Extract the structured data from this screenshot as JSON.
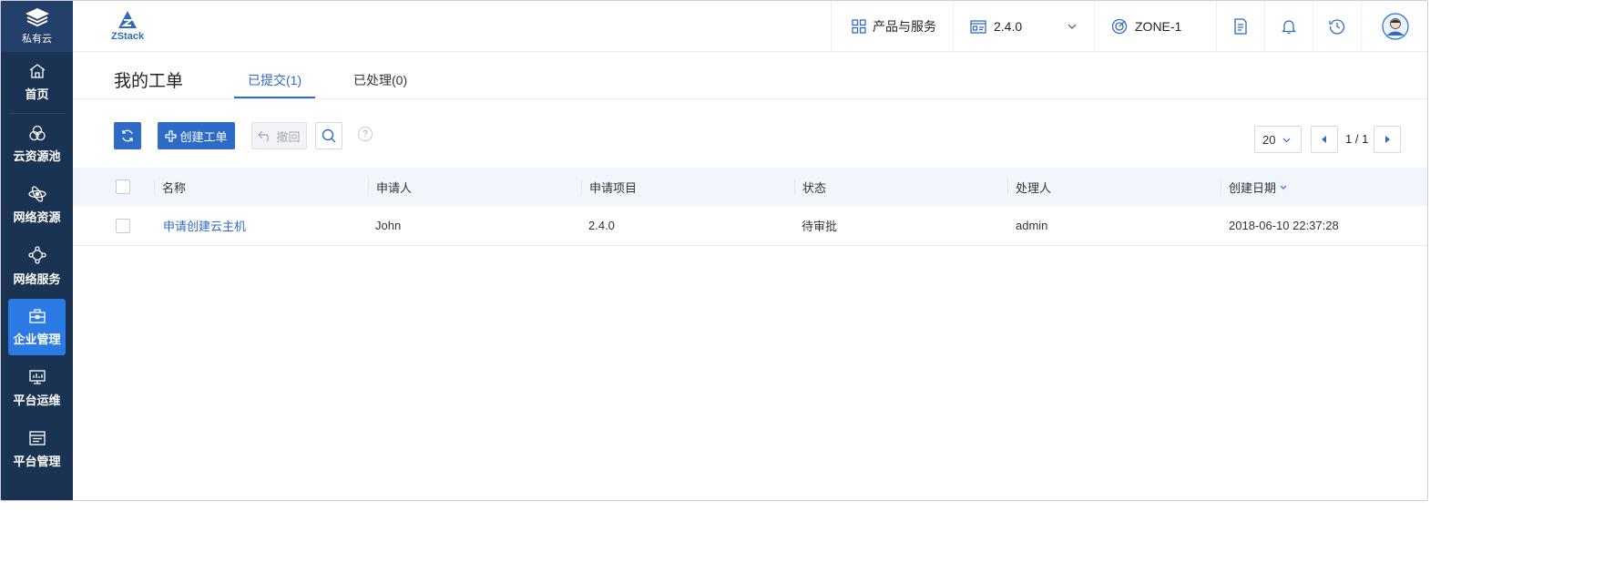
{
  "sidebar": {
    "brand_label": "私有云",
    "items": [
      {
        "label": "首页",
        "icon": "home-icon"
      },
      {
        "label": "云资源池",
        "icon": "resource-pool-icon"
      },
      {
        "label": "网络资源",
        "icon": "network-resource-icon"
      },
      {
        "label": "网络服务",
        "icon": "network-service-icon"
      },
      {
        "label": "企业管理",
        "icon": "enterprise-icon",
        "active": true
      },
      {
        "label": "平台运维",
        "icon": "monitor-icon"
      },
      {
        "label": "平台管理",
        "icon": "platform-manage-icon"
      }
    ]
  },
  "header": {
    "logo_text": "ZStack",
    "products_label": "产品与服务",
    "version_label": "2.4.0",
    "zone_label": "ZONE-1"
  },
  "page": {
    "title": "我的工单",
    "tabs": [
      {
        "label": "已提交(1)",
        "active": true
      },
      {
        "label": "已处理(0)",
        "active": false
      }
    ]
  },
  "toolbar": {
    "create_label": "创建工单",
    "revoke_label": "撤回",
    "help_glyph": "?"
  },
  "pager": {
    "page_size": "20",
    "page_info": "1 / 1"
  },
  "table": {
    "columns": [
      "名称",
      "申请人",
      "申请项目",
      "状态",
      "处理人",
      "创建日期"
    ],
    "rows": [
      {
        "name": "申请创建云主机",
        "applicant": "John",
        "project": "2.4.0",
        "status": "待审批",
        "handler": "admin",
        "created": "2018-06-10 22:37:28"
      }
    ]
  },
  "colors": {
    "sidebar_bg": "#1b3352",
    "accent": "#2e6bc6",
    "active_nav": "#2c7be5",
    "table_header_bg": "#f0f6fc"
  }
}
